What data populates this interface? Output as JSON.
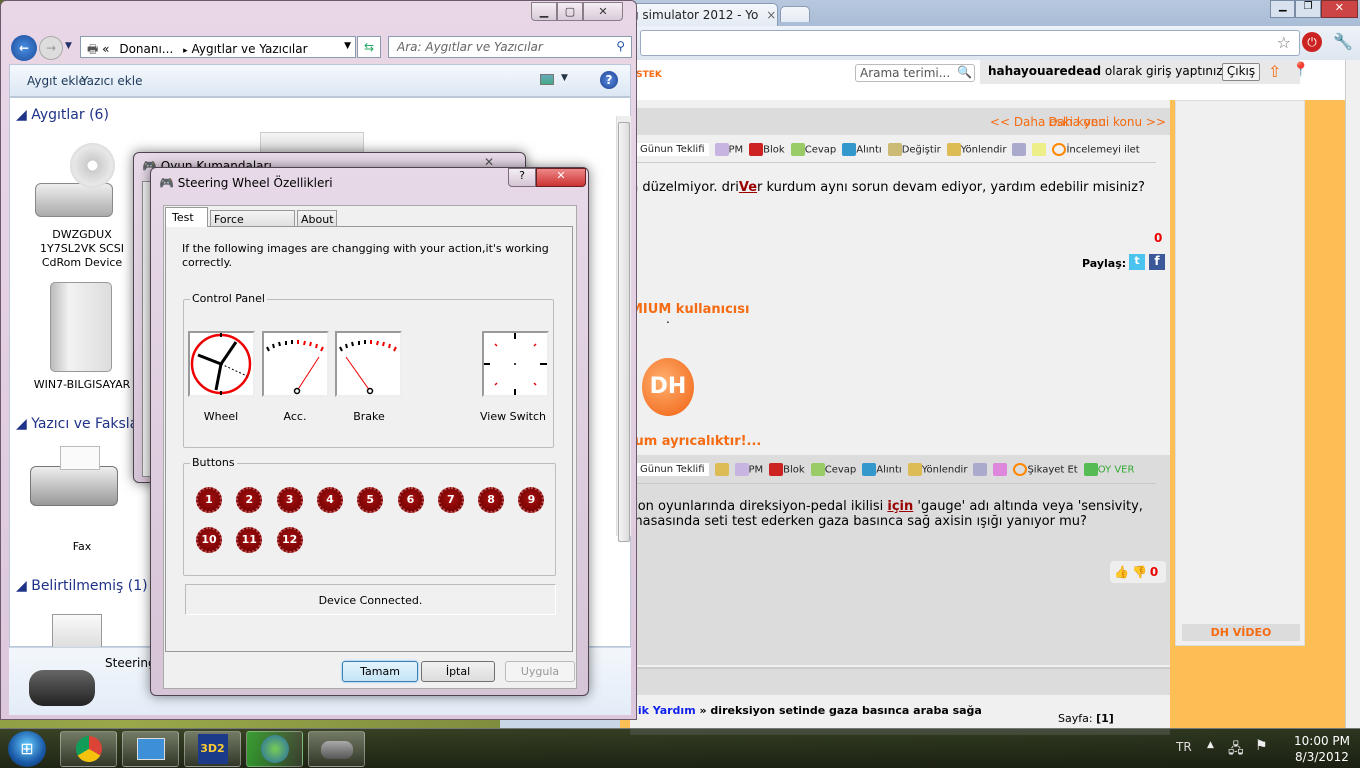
{
  "browser": {
    "tab_title": "g simulator 2012 - Yo",
    "tab_close": "×",
    "forum": {
      "nav_tag": "ESTEK",
      "search_placeholder": "Arama terimi...",
      "username": "hahayouaredead",
      "login_text": "olarak giriş yaptınız",
      "logout": "Çıkış",
      "prev_topic": "<< Daha eski konu",
      "next_topic": "Daha yeni konu >>",
      "post1": {
        "toolbar": [
          "Günun Teklifi",
          "PM",
          "Blok",
          "Cevap",
          "Alıntı",
          "Değiştir",
          "Yönlendir",
          "İncelemeyi ilet"
        ],
        "text_pre": "n düzelmiyor. dri",
        "text_link": "Ve",
        "text_post": "r kurdum aynı sorun devam ediyor, yardım edebilir misiniz?",
        "votes": "0",
        "share_label": "Paylaş:"
      },
      "premium_title": "MIUM kullanıcısı",
      "premium_dot": ".",
      "premium_slogan": "ium ayrıcalıktır!...",
      "logo_text": "DH",
      "post2": {
        "toolbar": [
          "Günun Teklifi",
          "PM",
          "Blok",
          "Cevap",
          "Alıntı",
          "Yönlendir",
          "Şikayet Et",
          "OY VER"
        ],
        "line1_pre": "yon oyunlarında direksiyon-pedal ikilisi ",
        "line1_link": "için",
        "line1_post": " 'gauge' adı altında veya 'sensivity,",
        "line2": " masasında seti test ederken gaza basınca sağ axisin ışığı yanıyor mu?",
        "votes": "0"
      },
      "bottom_bracket": "]",
      "breadcrumb_link": "nik Yardım",
      "breadcrumb_rest": " » direksiyon setinde gaza basınca araba sağa",
      "page_label": "Sayfa:",
      "page_value": "[1]",
      "sidebar_video": "DH VİDEO"
    }
  },
  "explorer": {
    "address_prefix": "«",
    "address_1": "Donanı...",
    "address_sep": "▸",
    "address_2": "Aygıtlar ve Yazıcılar",
    "search_placeholder": "Ara: Aygıtlar ve Yazıcılar",
    "toolbar": {
      "add_device": "Aygıt ekle",
      "add_printer": "Yazıcı ekle"
    },
    "groups": [
      {
        "title": "Aygıtlar (6)",
        "items": [
          "DWZGDUX 1Y7SL2VK SCSI CdRom Device",
          "WIN7-BILGISAYAR"
        ]
      },
      {
        "title": "Yazıcı ve Fakslar",
        "items": [
          "Fax"
        ]
      },
      {
        "title": "Belirtilmemiş (1)",
        "items": []
      }
    ],
    "details_name": "Steering"
  },
  "game_controllers": {
    "title": "Oyun Kumandaları"
  },
  "properties": {
    "title": "Steering Wheel Özellikleri",
    "tabs": [
      "Test",
      "Force Feedback",
      "About"
    ],
    "active_tab": "Test",
    "instructions": "If the following images are changging with your action,it's working correctly.",
    "control_panel_title": "Control Panel",
    "gauges": [
      "Wheel",
      "Acc.",
      "Brake",
      "View Switch"
    ],
    "buttons_title": "Buttons",
    "buttons": [
      "1",
      "2",
      "3",
      "4",
      "5",
      "6",
      "7",
      "8",
      "9",
      "10",
      "11",
      "12"
    ],
    "status": "Device Connected.",
    "ok": "Tamam",
    "cancel": "İptal",
    "apply": "Uygula"
  },
  "taskbar": {
    "apps": [
      "chrome-icon",
      "control-panel-icon",
      "3d2-icon",
      "download-manager-icon",
      "game-controller-icon"
    ],
    "language": "TR",
    "time": "10:00 PM",
    "date": "8/3/2012"
  },
  "colors": {
    "forum_orange": "#f46b12",
    "page_bg": "#fdbf55",
    "button_red": "#8b0000"
  }
}
